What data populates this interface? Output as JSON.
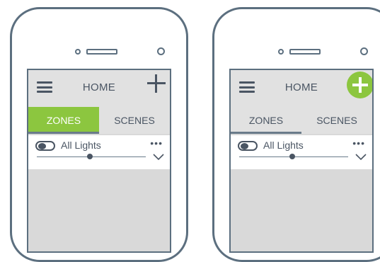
{
  "phones": [
    {
      "header": {
        "title": "HOME",
        "menu_icon": "menu-icon",
        "add_icon": "plus-icon"
      },
      "tabs": [
        {
          "label": "ZONES",
          "state": "active"
        },
        {
          "label": "SCENES",
          "state": "inactive"
        }
      ],
      "zone_row": {
        "label": "All Lights",
        "toggle": "on",
        "more_icon": "ellipsis-icon",
        "expand_icon": "chevron-down-icon"
      },
      "accent_color": "#8cc63f"
    },
    {
      "header": {
        "title": "HOME",
        "menu_icon": "menu-icon",
        "add_icon": "plus-circle-icon"
      },
      "tabs": [
        {
          "label": "ZONES",
          "state": "active"
        },
        {
          "label": "SCENES",
          "state": "inactive"
        }
      ],
      "zone_row": {
        "label": "All Lights",
        "toggle": "on",
        "more_icon": "ellipsis-icon",
        "expand_icon": "chevron-down-icon"
      },
      "accent_color": "#8cc63f"
    }
  ],
  "more_glyph": "•••"
}
